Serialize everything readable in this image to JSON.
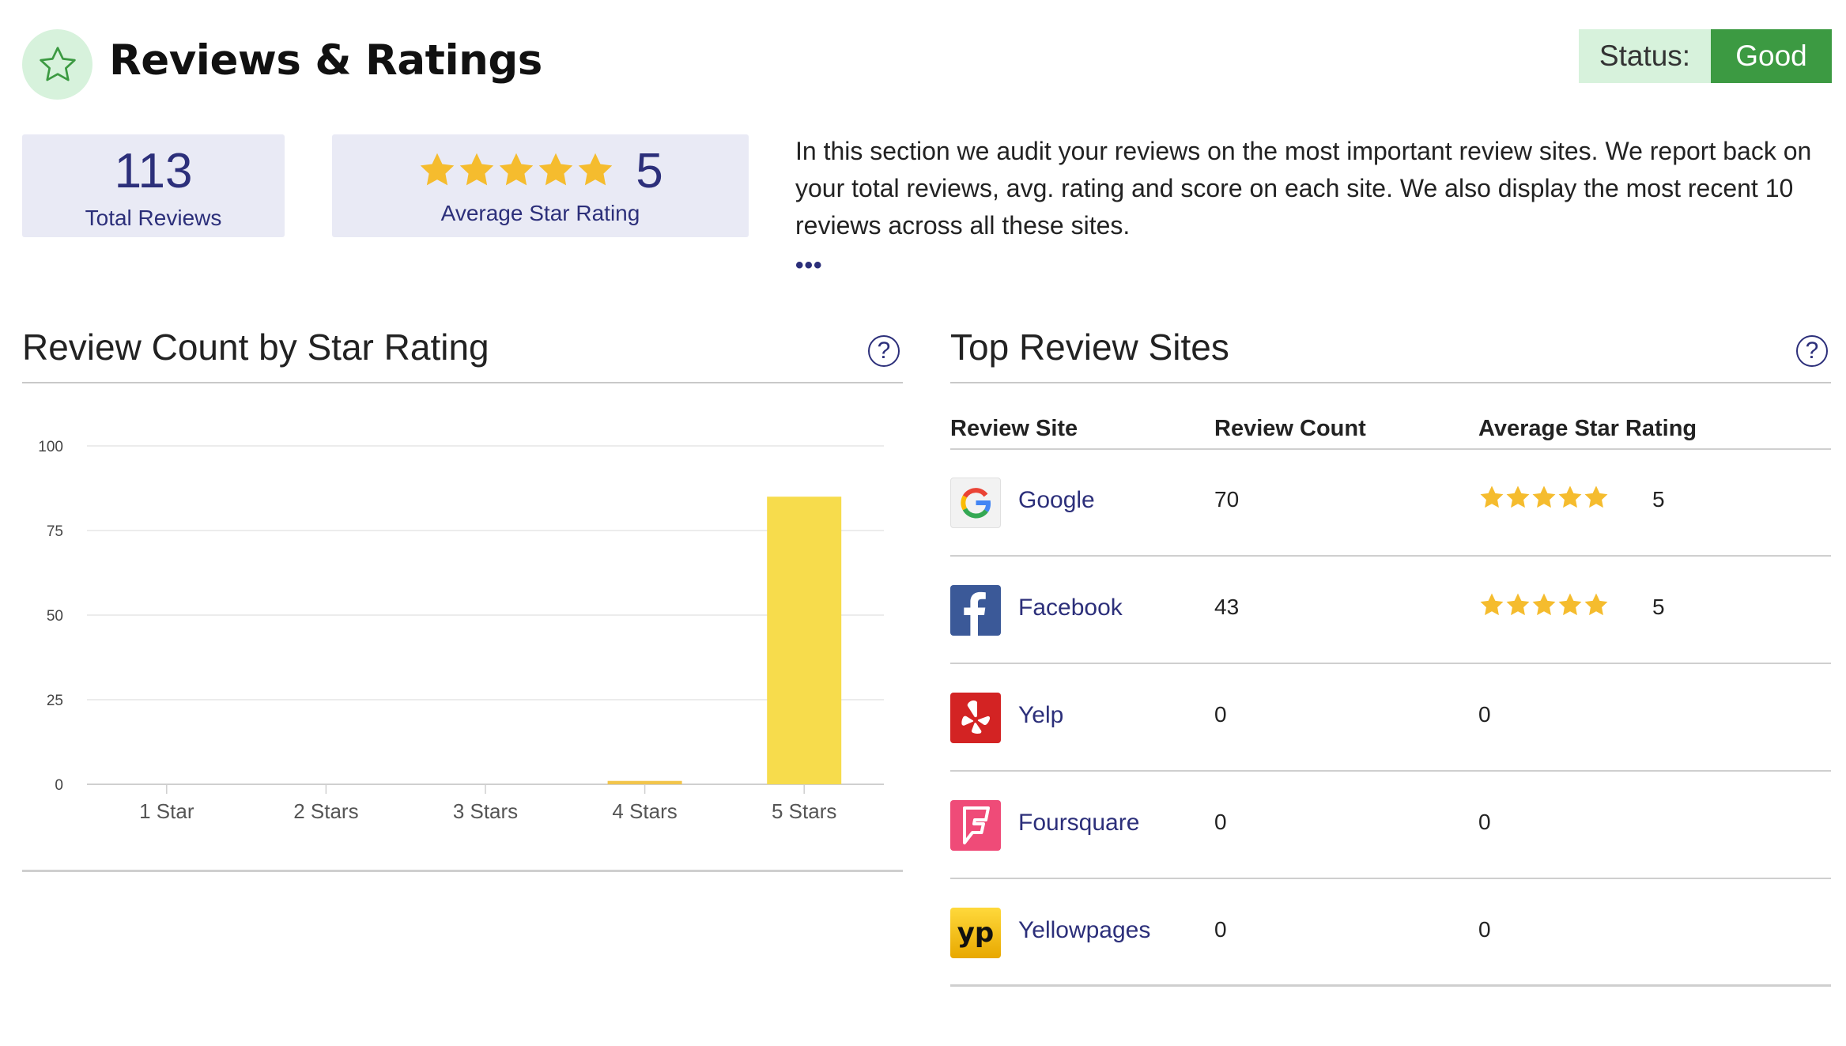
{
  "header": {
    "title": "Reviews & Ratings",
    "icon": "star-outline-icon",
    "status_label": "Status:",
    "status_value": "Good"
  },
  "summary": {
    "total_reviews": "113",
    "total_reviews_label": "Total Reviews",
    "average_rating": "5",
    "average_rating_label": "Average Star Rating",
    "average_stars": 5
  },
  "description": "In this section we audit your reviews on the most important review sites. We report back on your total reviews, avg. rating and score on each site. We also display the most recent 10 reviews across all these sites.",
  "more_indicator": "•••",
  "chart_section": {
    "title": "Review Count by Star Rating",
    "help_icon": "help-circle-icon"
  },
  "chart_data": {
    "type": "bar",
    "categories": [
      "1 Star",
      "2 Stars",
      "3 Stars",
      "4 Stars",
      "5 Stars"
    ],
    "values": [
      0,
      0,
      0,
      1,
      85
    ],
    "ylim": [
      0,
      100
    ],
    "yticks": [
      0,
      25,
      50,
      75,
      100
    ],
    "grid": true,
    "colors": {
      "main": "#f7dc4c",
      "minor": "#f2c54b"
    }
  },
  "sites_section": {
    "title": "Top Review Sites",
    "help_icon": "help-circle-icon",
    "columns": [
      "Review Site",
      "Review Count",
      "Average Star Rating"
    ],
    "rows": [
      {
        "site": "Google",
        "logo": "google-logo-icon",
        "count": "70",
        "rating": "5",
        "stars": 5
      },
      {
        "site": "Facebook",
        "logo": "facebook-logo-icon",
        "count": "43",
        "rating": "5",
        "stars": 5
      },
      {
        "site": "Yelp",
        "logo": "yelp-logo-icon",
        "count": "0",
        "rating": "0",
        "stars": 0
      },
      {
        "site": "Foursquare",
        "logo": "foursquare-logo-icon",
        "count": "0",
        "rating": "0",
        "stars": 0
      },
      {
        "site": "Yellowpages",
        "logo": "yellowpages-logo-icon",
        "count": "0",
        "rating": "0",
        "stars": 0
      }
    ]
  },
  "colors": {
    "accent_navy": "#2c2f7a",
    "status_good": "#3c9a42",
    "status_bg": "#d7f2dc",
    "star": "#f5bc2e",
    "card_bg": "#e9eaf5"
  }
}
